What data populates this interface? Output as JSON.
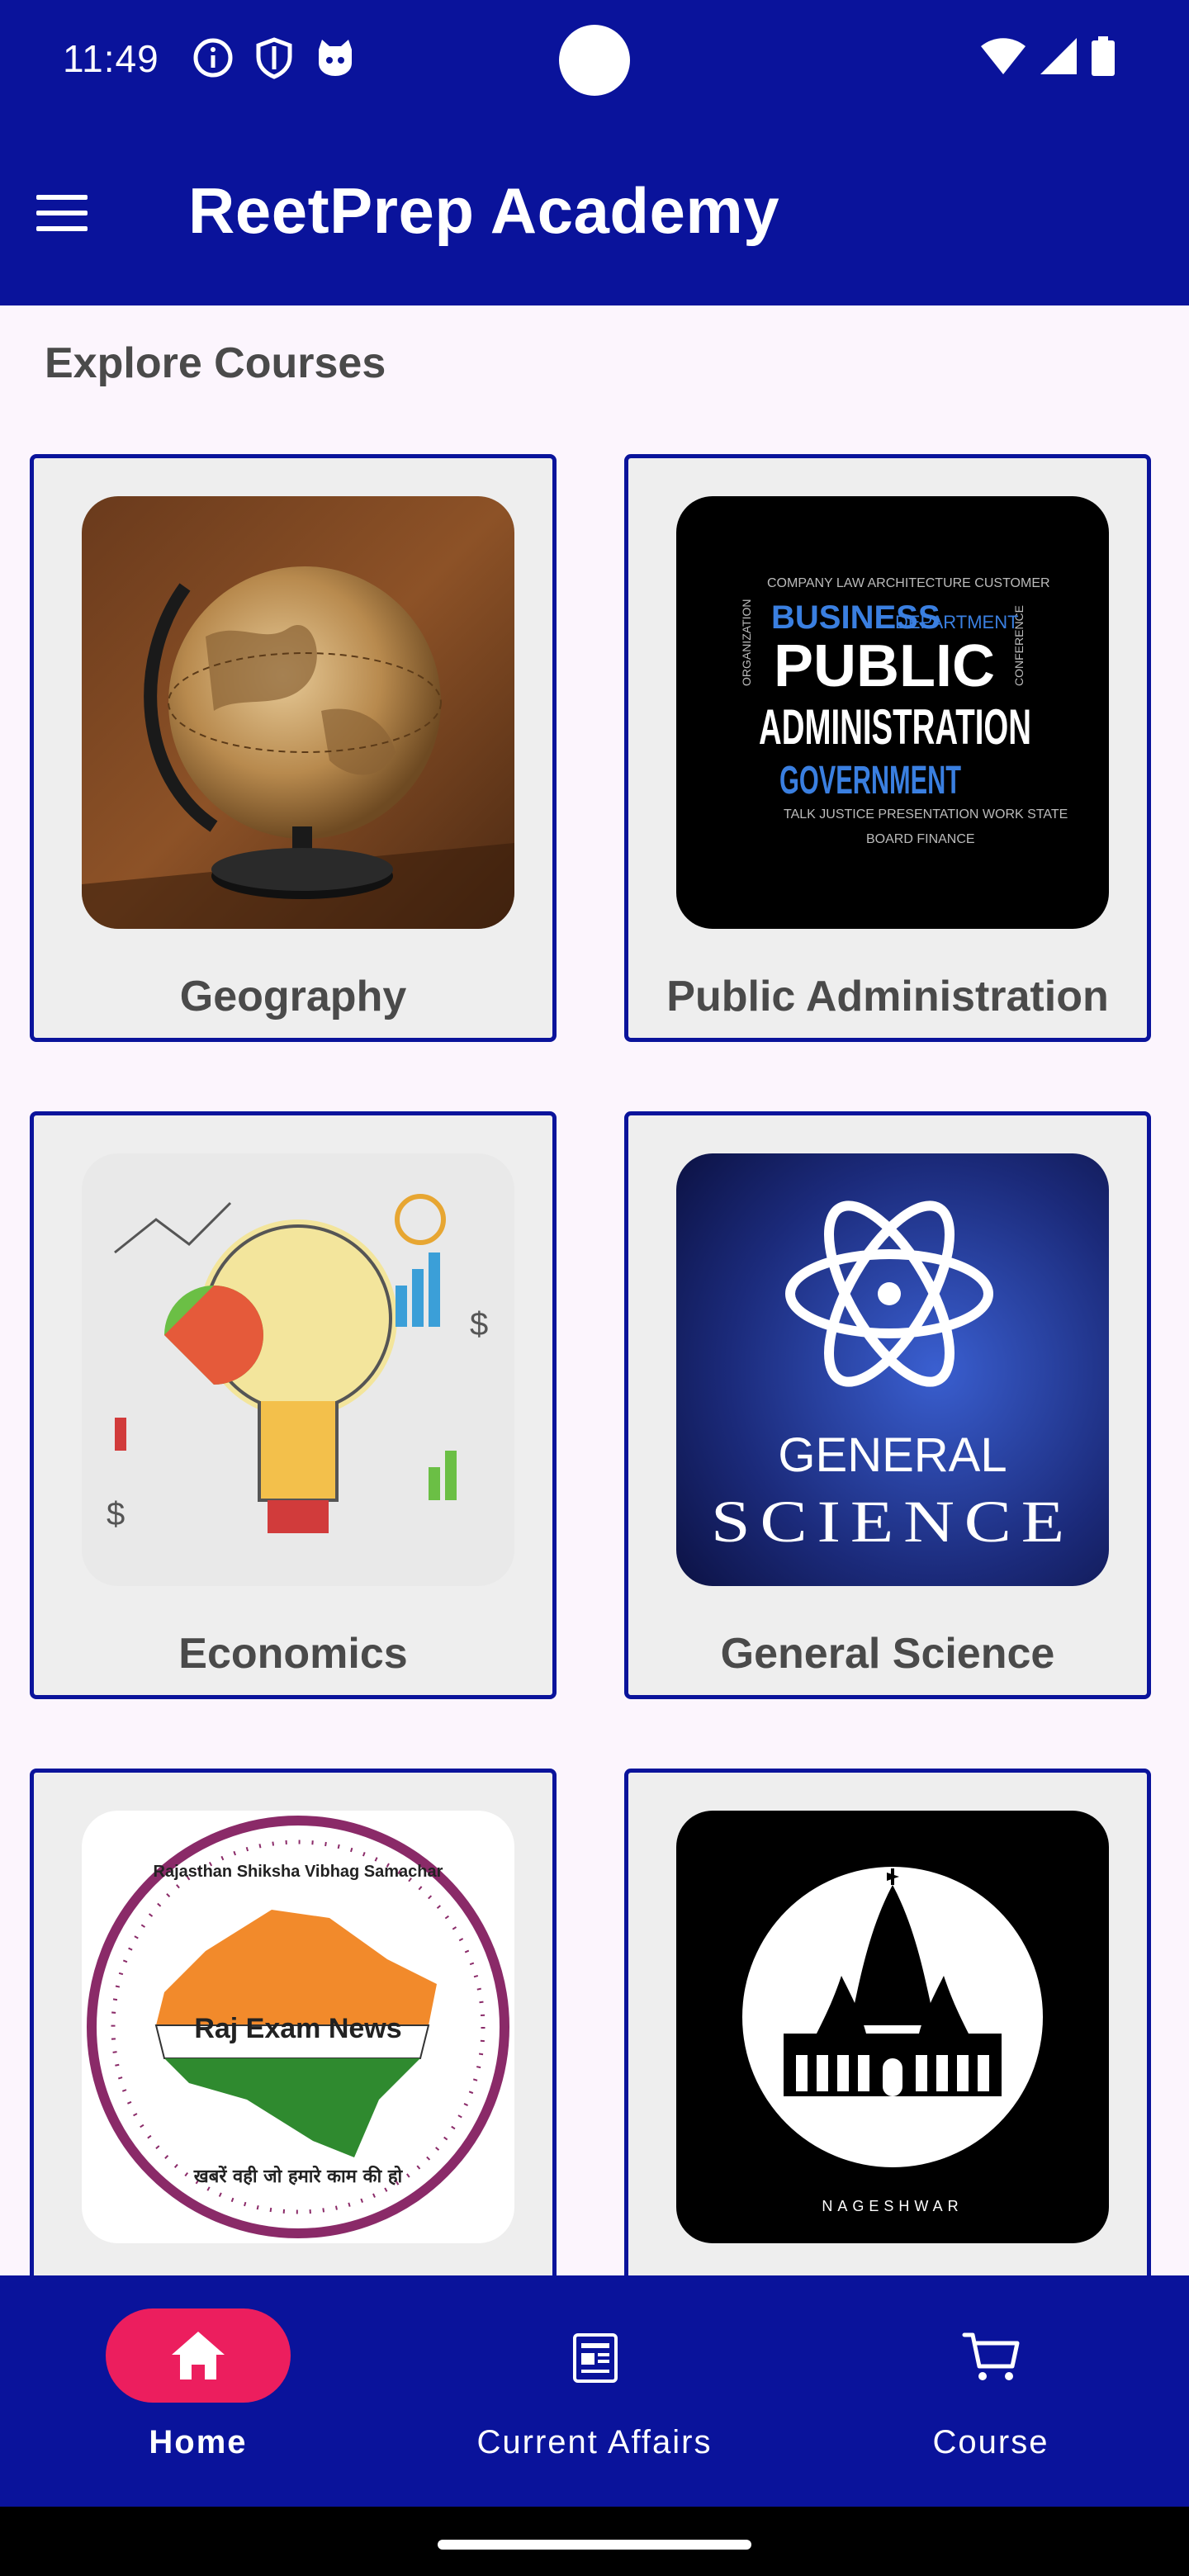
{
  "status_bar": {
    "time": "11:49",
    "icons": [
      "info-icon",
      "shield-icon",
      "cat-face-icon",
      "wifi-icon",
      "signal-icon",
      "battery-icon"
    ]
  },
  "app_bar": {
    "title": "ReetPrep Academy",
    "menu_icon": "hamburger-menu-icon"
  },
  "section_title": "Explore Courses",
  "courses": [
    {
      "label": "Geography"
    },
    {
      "label": "Public Administration",
      "image_text": [
        "PUBLIC",
        "ADMINISTRATION",
        "GOVERNMENT",
        "BUSINESS",
        "DEPARTMENT"
      ]
    },
    {
      "label": "Economics"
    },
    {
      "label": "General Science",
      "image_text": [
        "GENERAL",
        "SCIENCE"
      ]
    },
    {
      "label": "",
      "image_text": [
        "Raj Exam News",
        "Rajasthan Shiksha Vibhag Samachar",
        "खबरें वही जो हमारे काम की हो"
      ]
    },
    {
      "label": "",
      "image_text": [
        "NAGESHWAR"
      ]
    }
  ],
  "bottom_nav": {
    "items": [
      {
        "label": "Home",
        "icon": "home-icon",
        "active": true
      },
      {
        "label": "Current Affairs",
        "icon": "newspaper-icon",
        "active": false
      },
      {
        "label": "Course",
        "icon": "cart-icon",
        "active": false
      }
    ]
  },
  "colors": {
    "primary": "#0a139b",
    "accent": "#ec1e5e",
    "background": "#fcf5fd",
    "card": "#eeeeee",
    "text": "#4a4a4a"
  }
}
